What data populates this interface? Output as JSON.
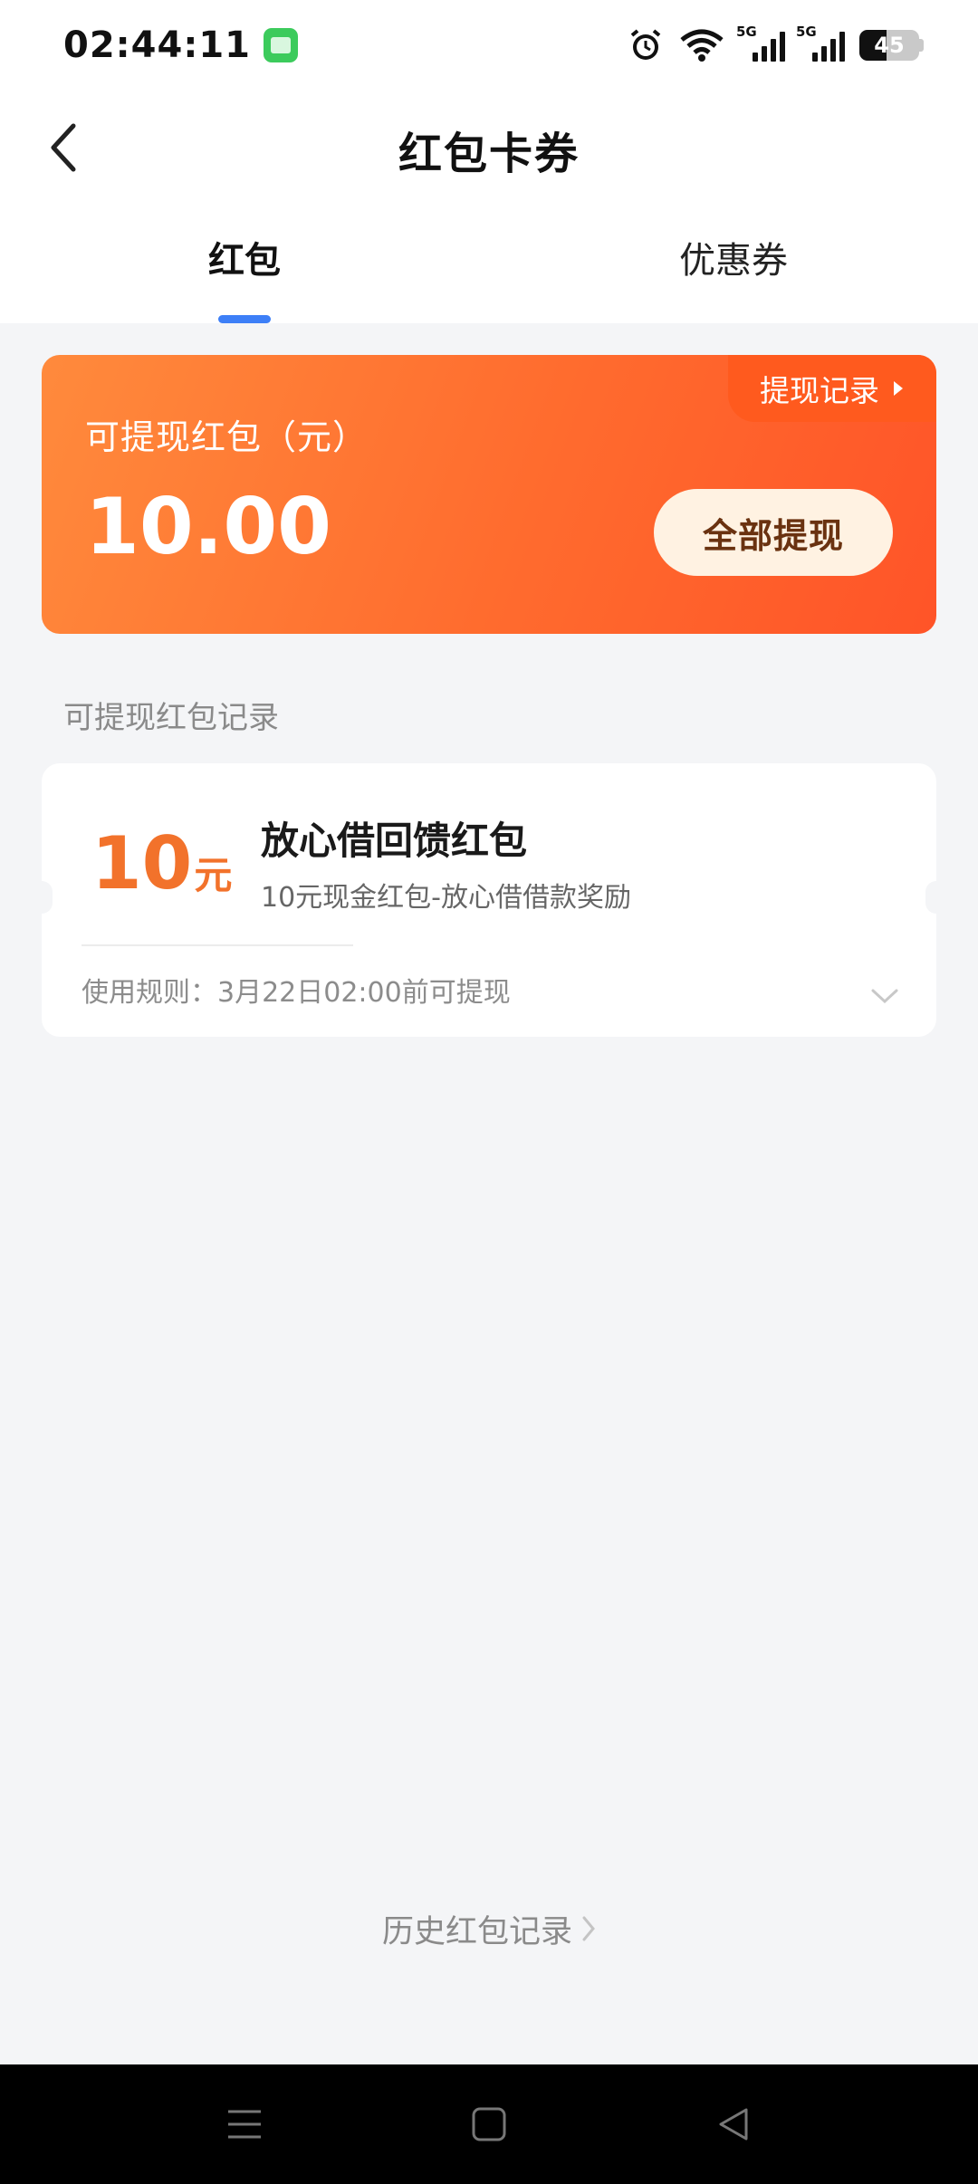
{
  "status_bar": {
    "time": "02:44:11",
    "icons": [
      "message-app-icon",
      "alarm-icon",
      "wifi-icon",
      "5g-signal-icon",
      "5g-signal-icon",
      "battery-icon"
    ],
    "signal_tag_1": "5G",
    "signal_tag_2": "5G",
    "battery_level": "45"
  },
  "header": {
    "title": "红包卡券",
    "back_icon": "chevron-left-icon"
  },
  "tabs": [
    {
      "label": "红包",
      "active": true
    },
    {
      "label": "优惠券",
      "active": false
    }
  ],
  "balance_card": {
    "label": "可提现红包（元）",
    "amount": "10.00",
    "record_link": "提现记录",
    "withdraw_all": "全部提现"
  },
  "section": {
    "title": "可提现红包记录"
  },
  "coupons": [
    {
      "amount": "10",
      "unit": "元",
      "title": "放心借回馈红包",
      "desc": "10元现金红包-放心借借款奖励",
      "rule": "使用规则：3月22日02:00前可提现"
    }
  ],
  "footer": {
    "history_link": "历史红包记录"
  },
  "system_nav": {
    "icons": [
      "menu-icon",
      "home-icon",
      "back-triangle-icon"
    ]
  },
  "colors": {
    "accent_blue": "#3d7ff7",
    "card_orange": "#ff6b2e",
    "coupon_orange": "#f2722b",
    "background": "#f4f5f7"
  }
}
